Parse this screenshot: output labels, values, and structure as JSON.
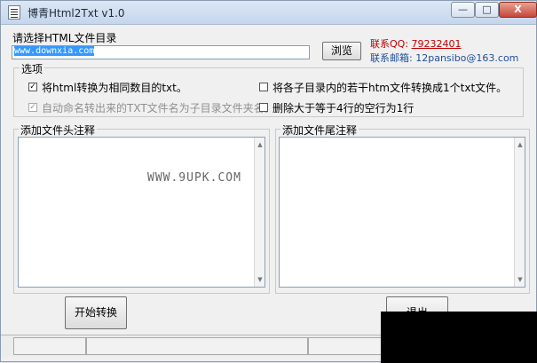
{
  "window": {
    "title": "博青Html2Txt v1.0",
    "controls": {
      "minimize": "—",
      "maximize": "□",
      "close": "X"
    }
  },
  "directory": {
    "label": "请选择HTML文件目录",
    "value": "www.downxia.com",
    "browse_label": "浏览"
  },
  "contact": {
    "qq_label": "联系QQ:",
    "qq_value": "79232401",
    "email_label": "联系邮箱:",
    "email_value": "12pansibo@163.com"
  },
  "options": {
    "title": "选项",
    "items": [
      {
        "label": "将html转换为相同数目的txt。",
        "checked": true,
        "disabled": false
      },
      {
        "label": "将各子目录内的若干htm文件转换成1个txt文件。",
        "checked": false,
        "disabled": false
      },
      {
        "label": "自动命名转出来的TXT文件名为子目录文件夹名。",
        "checked": true,
        "disabled": true
      },
      {
        "label": "删除大于等于4行的空行为1行",
        "checked": false,
        "disabled": false
      }
    ]
  },
  "header_comment": {
    "title": "添加文件头注释",
    "watermark": "WWW.9UPK.COM"
  },
  "footer_comment": {
    "title": "添加文件尾注释"
  },
  "actions": {
    "start_label": "开始转换",
    "exit_partial_label": "退出"
  },
  "colors": {
    "accent_red": "#c00000",
    "accent_blue": "#1f4e9a",
    "selection_blue": "#3399ff"
  }
}
